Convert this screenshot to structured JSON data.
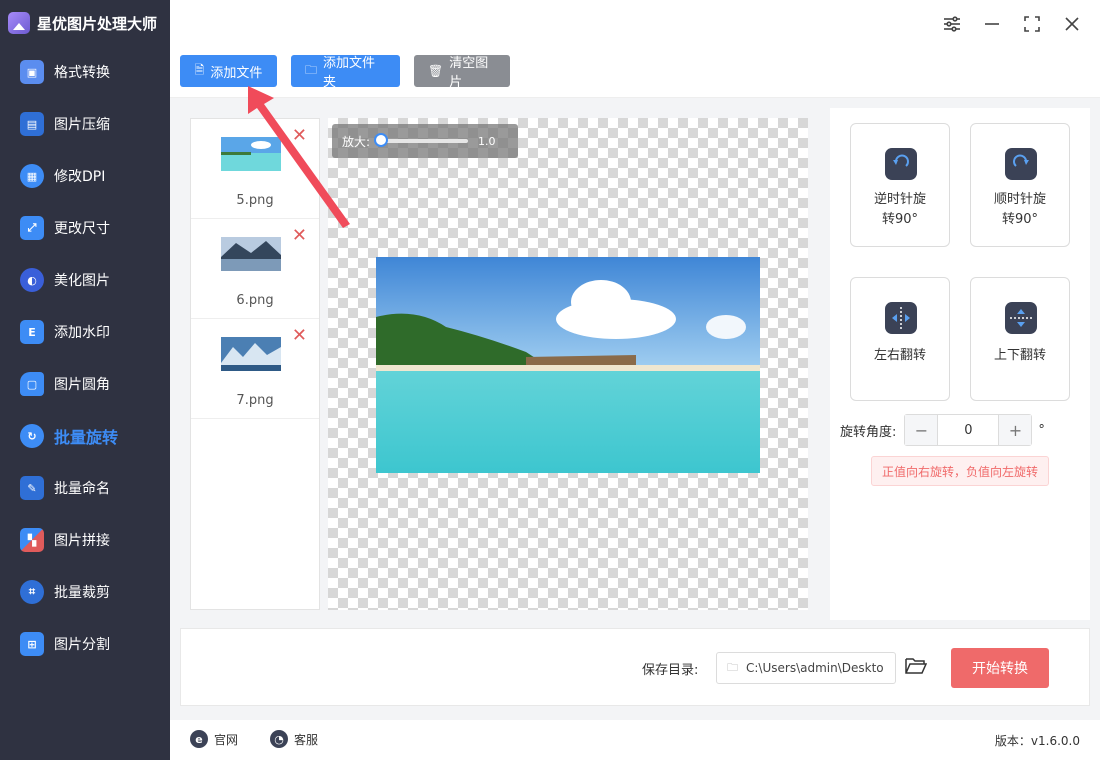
{
  "app": {
    "title": "星优图片处理大师"
  },
  "sidebar": {
    "items": [
      {
        "label": "格式转换",
        "icon": "image-convert-icon",
        "color": "#5b8def"
      },
      {
        "label": "图片压缩",
        "icon": "image-compress-icon",
        "color": "#3d8cf5"
      },
      {
        "label": "修改DPI",
        "icon": "dpi-icon",
        "color": "#3d8cf5"
      },
      {
        "label": "更改尺寸",
        "icon": "resize-icon",
        "color": "#3d8cf5"
      },
      {
        "label": "美化图片",
        "icon": "beautify-icon",
        "color": "#3d8cf5"
      },
      {
        "label": "添加水印",
        "icon": "watermark-icon",
        "color": "#3d8cf5"
      },
      {
        "label": "图片圆角",
        "icon": "round-corner-icon",
        "color": "#3d8cf5"
      },
      {
        "label": "批量旋转",
        "icon": "rotate-icon",
        "color": "#3d8cf5",
        "active": true
      },
      {
        "label": "批量命名",
        "icon": "rename-icon",
        "color": "#3d8cf5"
      },
      {
        "label": "图片拼接",
        "icon": "splice-icon",
        "color": "#3d8cf5"
      },
      {
        "label": "批量裁剪",
        "icon": "crop-icon",
        "color": "#3d8cf5"
      },
      {
        "label": "图片分割",
        "icon": "split-icon",
        "color": "#3d8cf5"
      }
    ]
  },
  "toolbar": {
    "add_file": "添加文件",
    "add_folder": "添加文件夹",
    "clear": "清空图片",
    "add_file_color": "#3d8cf5",
    "add_folder_color": "#3d8cf5",
    "clear_color": "#8a8d93"
  },
  "files": [
    {
      "name": "5.png"
    },
    {
      "name": "6.png"
    },
    {
      "name": "7.png"
    }
  ],
  "preview": {
    "zoom_label": "放大:",
    "zoom_value": "1.0"
  },
  "ops": {
    "ccw_line1": "逆时针旋",
    "ccw_line2": "转90°",
    "cw_line1": "顺时针旋",
    "cw_line2": "转90°",
    "flip_h": "左右翻转",
    "flip_v": "上下翻转",
    "angle_label": "旋转角度:",
    "angle_value": "0",
    "minus": "−",
    "plus": "+",
    "degree": "°",
    "tip": "正值向右旋转，负值向左旋转"
  },
  "save": {
    "label": "保存目录:",
    "path": "C:\\Users\\admin\\Deskto",
    "start": "开始转换"
  },
  "footer": {
    "website": "官网",
    "service": "客服",
    "version": "版本：v1.6.0.0"
  }
}
